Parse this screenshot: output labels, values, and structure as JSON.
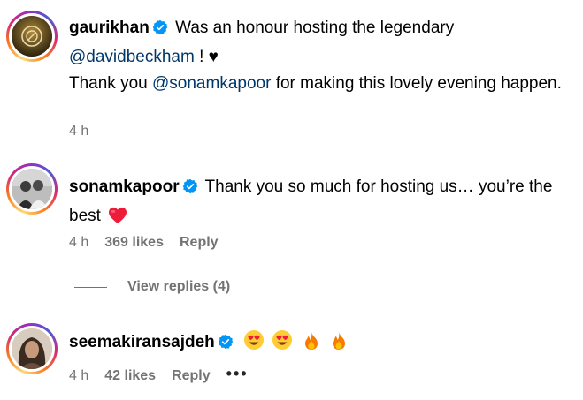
{
  "comments": [
    {
      "username": "gaurikhan",
      "text_1": "Was an honour hosting the legendary",
      "mention_1": "@davidbeckham",
      "text_2": " ! ♥",
      "text_3": "Thank you ",
      "mention_2": "@sonamkapoor",
      "text_4": " for making this lovely evening happen.",
      "time": "4 h"
    },
    {
      "username": "sonamkapoor",
      "text_1": "Thank you so much for hosting us… you’re the best",
      "time": "4 h",
      "likes": "369 likes",
      "reply": "Reply",
      "view_replies": "View replies (4)"
    },
    {
      "username": "seemakiransajdeh",
      "time": "4 h",
      "likes": "42 likes",
      "reply": "Reply",
      "more": "•••"
    }
  ],
  "colors": {
    "mention": "#00376b",
    "meta": "#737373",
    "verified": "#0095f6",
    "heart": "#ed4956"
  }
}
